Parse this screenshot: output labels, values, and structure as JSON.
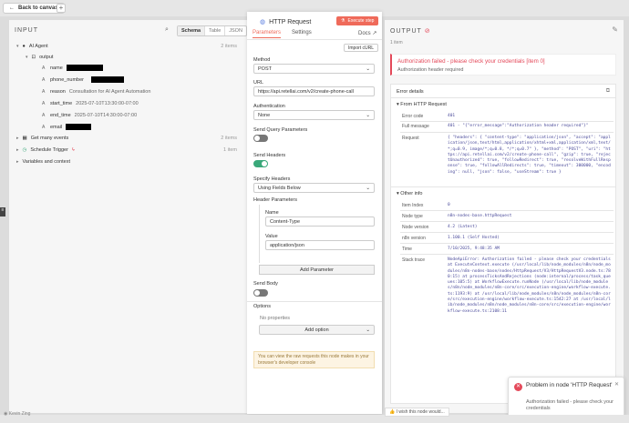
{
  "topbar": {
    "back_label": "Back to canvas",
    "add_label": "+"
  },
  "input": {
    "title": "INPUT",
    "tabs": [
      "Schema",
      "Table",
      "JSON"
    ],
    "active_tab": "Schema",
    "ai_agent": {
      "label": "AI Agent",
      "count": "2 items"
    },
    "output_label": "output",
    "fields": [
      {
        "key": "name",
        "value": ""
      },
      {
        "key": "phone_number",
        "value": ""
      },
      {
        "key": "reason",
        "value": "Consultation for AI Agent Automation"
      },
      {
        "key": "start_time",
        "value": "2025-07-10T13:30:00-07:00"
      },
      {
        "key": "end_time",
        "value": "2025-07-10T14:30:00-07:00"
      },
      {
        "key": "email",
        "value": ""
      }
    ],
    "get_many": {
      "label": "Get many events",
      "count": "2 items"
    },
    "schedule": {
      "label": "Schedule Trigger",
      "count": "1 item"
    },
    "variables_label": "Variables and context"
  },
  "node": {
    "title": "HTTP Request",
    "execute_label": "Execute step",
    "tab_parameters": "Parameters",
    "tab_settings": "Settings",
    "docs_label": "Docs",
    "import_curl": "Import cURL",
    "method_label": "Method",
    "method_value": "POST",
    "url_label": "URL",
    "url_value": "https://api.retellai.com/v2/create-phone-call",
    "auth_label": "Authentication",
    "auth_value": "None",
    "send_query_label": "Send Query Parameters",
    "send_headers_label": "Send Headers",
    "specify_headers_label": "Specify Headers",
    "specify_headers_value": "Using Fields Below",
    "header_params_label": "Header Parameters",
    "name_label": "Name",
    "name_value": "Content-Type",
    "value_label": "Value",
    "value_value": "application/json",
    "add_parameter": "Add Parameter",
    "send_body_label": "Send Body",
    "options_label": "Options",
    "no_properties": "No properties",
    "add_option": "Add option",
    "hint": "You can view the raw requests this node makes in your browser's developer console"
  },
  "output": {
    "title": "OUTPUT",
    "items": "1 item",
    "alert_title": "Authorization failed - please check your credentials [item 0]",
    "alert_sub": "Authorization header required",
    "error_details_label": "Error details",
    "from_label": "From HTTP Request",
    "error_code_k": "Error code",
    "error_code_v": "401",
    "full_message_k": "Full message",
    "full_message_v": "401 - \"{\"error_message\":\"Authorization header required\"}\"",
    "request_k": "Request",
    "request_v": "{ \"headers\": { \"content-type\": \"application/json\", \"accept\": \"application/json,text/html,application/xhtml+xml,application/xml,text/*;q=0.9, image/*;q=0.8, */*;q=0.7\" }, \"method\": \"POST\", \"uri\": \"https://api.retellai.com/v2/create-phone-call\", \"gzip\": true, \"rejectUnauthorized\": true, \"followRedirect\": true, \"resolveWithFullResponse\": true, \"followAllRedirects\": true, \"timeout\": 300000, \"encoding\": null, \"json\": false, \"useStream\": true }",
    "other_info_label": "Other info",
    "item_index_k": "Item Index",
    "item_index_v": "0",
    "node_type_k": "Node type",
    "node_type_v": "n8n-nodes-base.httpRequest",
    "node_version_k": "Node version",
    "node_version_v": "4.2 (Latest)",
    "n8n_version_k": "n8n version",
    "n8n_version_v": "1.100.1 (Self Hosted)",
    "time_k": "Time",
    "time_v": "7/10/2025, 9:48:35 AM",
    "stack_k": "Stack trace",
    "stack_v": "NodeApiError: Authorization failed - please check your credentials at ExecuteContext.execute (/usr/local/lib/node_modules/n8n/node_modules/n8n-nodes-base/nodes/HttpRequest/V3/HttpRequestV3.node.ts:780:15) at processTicksAndRejections (node:internal/process/task_queues:105:5) at WorkflowExecute.runNode (/usr/local/lib/node_modules/n8n/node_modules/n8n-core/src/execution-engine/workflow-execute.ts:1193:9) at /usr/local/lib/node_modules/n8n/node_modules/n8n-core/src/execution-engine/workflow-execute.ts:1542:27 at /usr/local/lib/node_modules/n8n/node_modules/n8n-core/src/execution-engine/workflow-execute.ts:2108:11"
  },
  "toast": {
    "title": "Problem in node 'HTTP Request'",
    "message": "Authorization failed - please check your credentials"
  },
  "footer": {
    "user": "Kevin Zing",
    "wish": "I wish this node would..."
  },
  "colors": {
    "accent": "#ef6a5a",
    "error": "#e4495a",
    "toggle_on": "#3aa87a"
  }
}
